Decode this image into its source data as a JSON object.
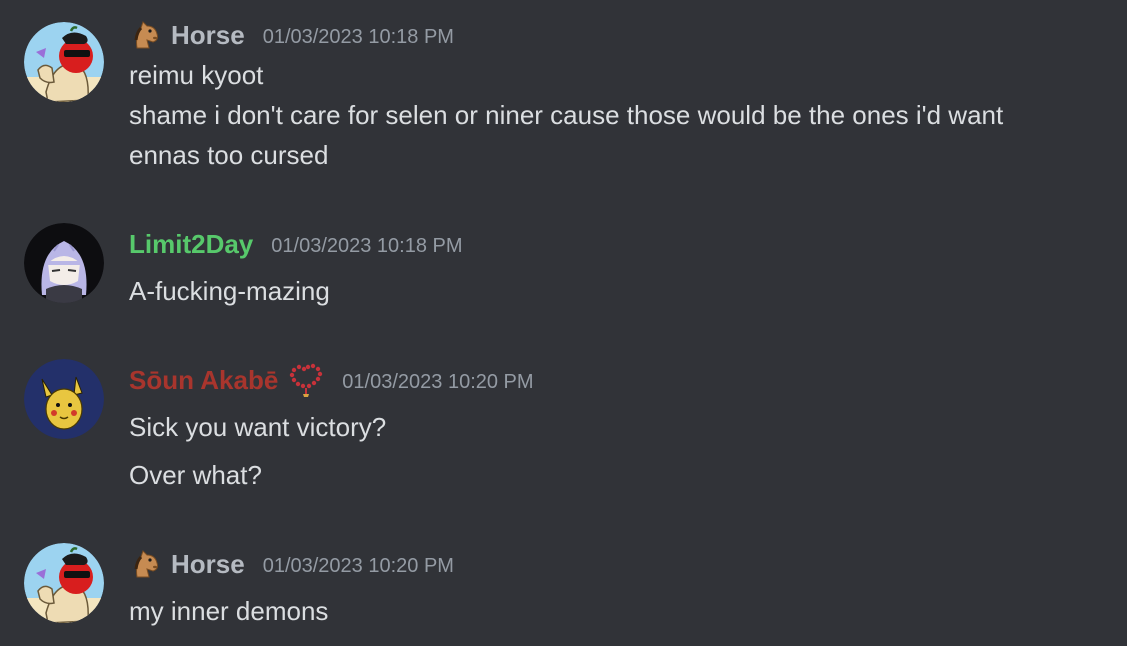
{
  "colors": {
    "background": "#313338",
    "text": "#dbdee1",
    "timestamp": "#949ba4",
    "horse_name": "#b5bac1",
    "limit_name": "#57c96b",
    "soun_name": "#a8352d"
  },
  "messages": [
    {
      "author": "Horse",
      "author_icon": "horse-emoji-icon",
      "timestamp": "01/03/2023 10:18 PM",
      "lines": [
        "reimu kyoot",
        "shame i don't care for selen or niner cause those would be the ones i'd want",
        "ennas too cursed"
      ]
    },
    {
      "author": "Limit2Day",
      "timestamp": "01/03/2023 10:18 PM",
      "lines": [
        "A-fucking-mazing"
      ]
    },
    {
      "author": "Sōun Akabē",
      "author_badge": "prayer-beads-icon",
      "timestamp": "01/03/2023 10:20 PM",
      "lines": [
        "Sick you want victory?",
        "Over what?"
      ]
    },
    {
      "author": "Horse",
      "author_icon": "horse-emoji-icon",
      "timestamp": "01/03/2023 10:20 PM",
      "lines": [
        "my inner demons"
      ]
    }
  ]
}
